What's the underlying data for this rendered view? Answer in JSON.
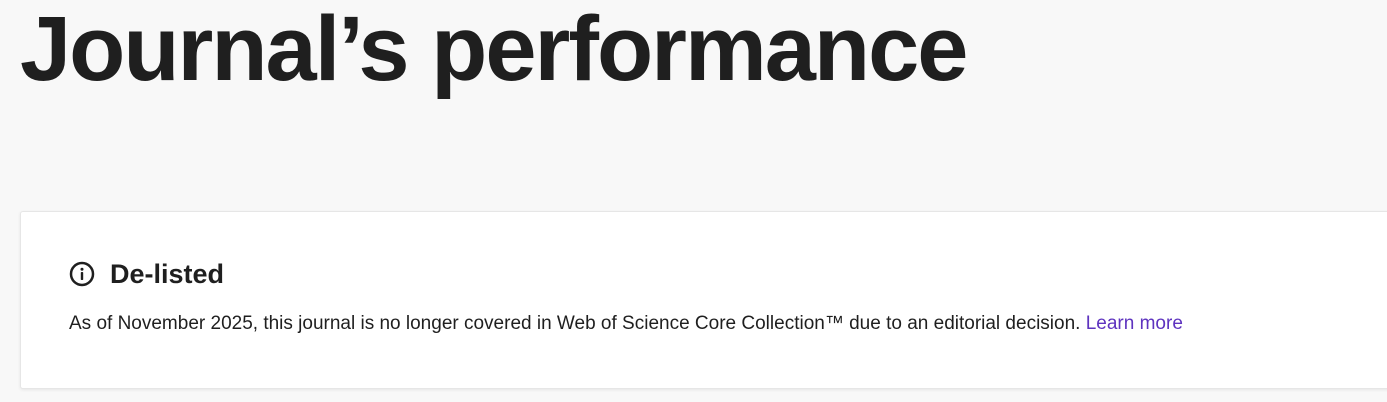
{
  "header": {
    "title": "Journal’s performance"
  },
  "status_card": {
    "icon": "info-circle-icon",
    "heading": "De-listed",
    "message": "As of November 2025, this journal is no longer covered in Web of Science Core Collection™ due to an editorial decision.",
    "link_label": "Learn more",
    "link_color": "#5e33bf"
  }
}
